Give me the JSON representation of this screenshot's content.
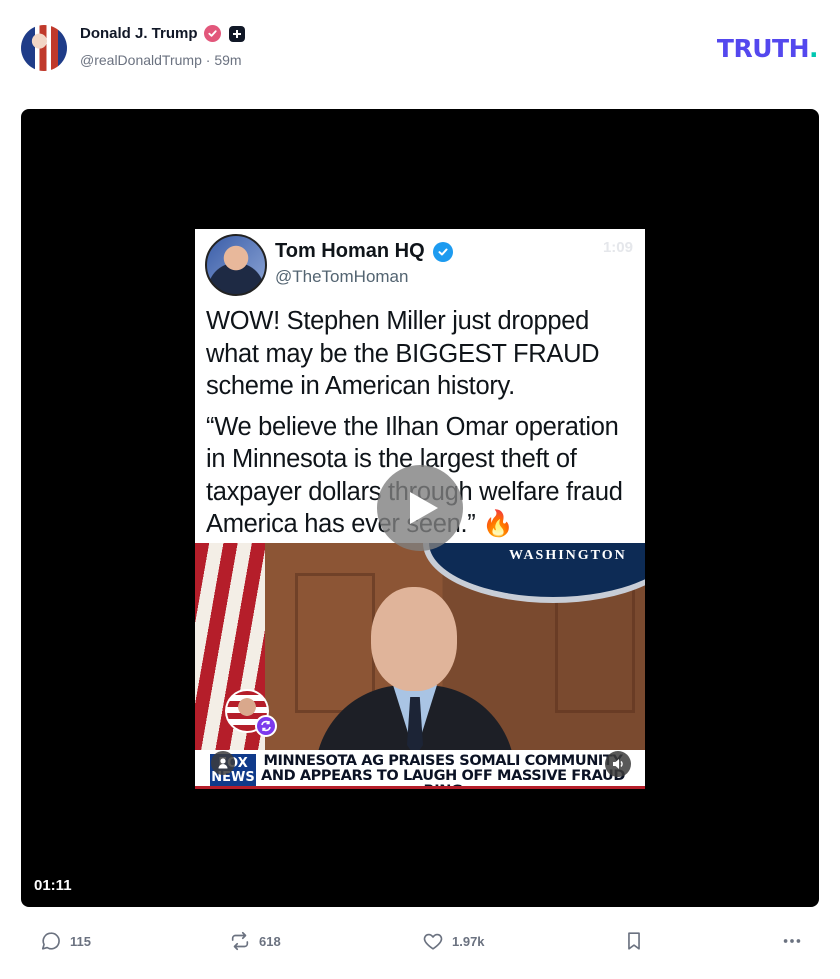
{
  "post": {
    "author_name": "Donald J. Trump",
    "handle": "@realDonaldTrump",
    "time": "59m",
    "separator": "·"
  },
  "brand": {
    "logo_text": "TRUTH",
    "logo_dot": ".",
    "accent_color": "#5448ee",
    "dot_color": "#00c7b1"
  },
  "video": {
    "duration": "01:11",
    "play_icon": "play-icon"
  },
  "tweet": {
    "name": "Tom Homan HQ",
    "handle": "@TheTomHoman",
    "ghost_time": "1:09",
    "paragraph1": "WOW! Stephen Miller just dropped what may be the BIGGEST FRAUD scheme in American history.",
    "paragraph2": "“We believe the Ilhan Omar operation in Minnesota is the largest theft of taxpayer dollars through welfare fraud America has ever seen.” 🔥"
  },
  "news": {
    "seal_text": "WASHINGTON",
    "network_logo": "FOX NEWS",
    "chyron_line1": "MINNESOTA AG PRAISES SOMALI COMMUNITY",
    "chyron_line2": "AND APPEARS TO LAUGH OFF MASSIVE FRAUD RING"
  },
  "actions": {
    "replies": "115",
    "reposts": "618",
    "likes": "1.97k"
  }
}
